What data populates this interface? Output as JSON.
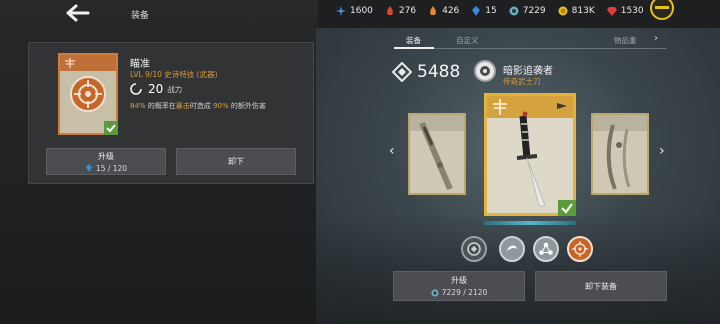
{
  "header": {
    "title": "装备",
    "currencies": [
      {
        "icon": "sparkle-icon",
        "value": "1600",
        "color": "#4f8fd8"
      },
      {
        "icon": "flame-red-icon",
        "value": "276",
        "color": "#d24a3a"
      },
      {
        "icon": "flame-orange-icon",
        "value": "426",
        "color": "#e08a2a"
      },
      {
        "icon": "crystal-blue-icon",
        "value": "15",
        "color": "#3a8ad8"
      },
      {
        "icon": "gear-coin-icon",
        "value": "7229",
        "color": "#6ab0c0"
      },
      {
        "icon": "gold-coin-icon",
        "value": "813K",
        "color": "#e8c11a"
      },
      {
        "icon": "ruby-icon",
        "value": "1530",
        "color": "#e03a3a"
      }
    ]
  },
  "skill": {
    "name": "瞄准",
    "level_line": "LVL  9/10  史诗特技 (武器)",
    "power": "20",
    "power_label": "战力",
    "desc_pre": "84%",
    "desc_mid1": " 的概率在",
    "desc_hl": "暴击",
    "desc_mid2": "时造成 ",
    "desc_pct": "90%",
    "desc_post": " 的额外伤害",
    "upgrade_label": "升级",
    "upgrade_cost": "15 / 120",
    "unequip_label": "卸下"
  },
  "tabs": {
    "equip": "装备",
    "custom": "自定义",
    "items": "物品重"
  },
  "weapon": {
    "power": "5488",
    "name": "暗影追袭者",
    "type": "传奇武士刀",
    "upgrade_label": "升级",
    "upgrade_cost": "7229 / 2120",
    "equip_label": "卸下装备"
  },
  "colors": {
    "accent_gold": "#e3b43b",
    "epic_orange": "#d69a3a",
    "equipped_green": "#5c9b3a"
  }
}
